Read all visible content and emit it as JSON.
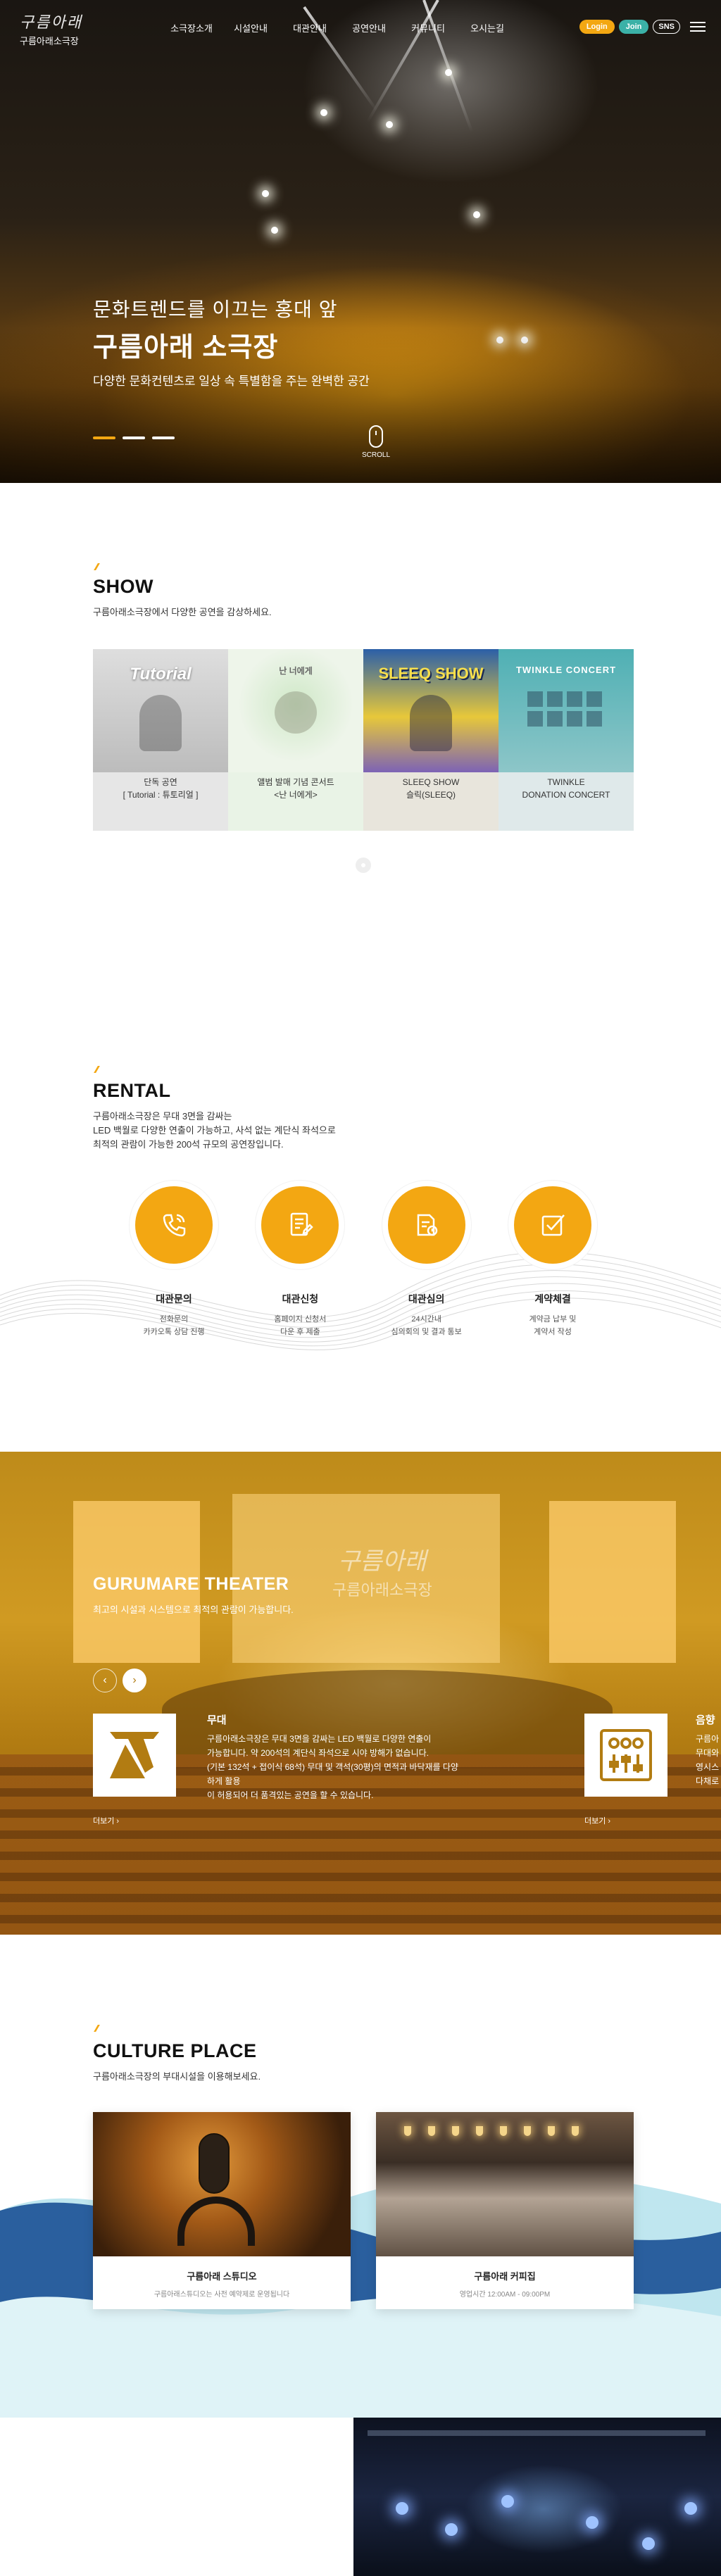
{
  "header": {
    "logo_art": "구름아래",
    "logo_text": "구름아래소극장",
    "nav": [
      "소극장소개",
      "시설안내",
      "대관안내",
      "공연안내",
      "커뮤니티",
      "오시는길"
    ],
    "login": "Login",
    "join": "Join",
    "sns": "SNS"
  },
  "hero": {
    "subtitle": "문화트렌드를 이끄는 홍대 앞",
    "title": "구름아래 소극장",
    "desc": "다양한 문화컨텐츠로 일상 속 특별함을 주는 완벽한 공간",
    "scroll": "SCROLL",
    "slides": 3,
    "active_slide": 1
  },
  "show": {
    "title": "SHOW",
    "desc": "구름아래소극장에서 다양한 공연을 감상하세요.",
    "cards": [
      {
        "poster_title": "Tutorial",
        "line1": "단독 공연",
        "line2": "[ Tutorial : 튜토리얼 ]"
      },
      {
        "poster_title": "난 너에게",
        "line1": "앨범 발매 기념 콘서트",
        "line2": "<난 너에게>"
      },
      {
        "poster_title": "SLEEQ SHOW",
        "line1": "SLEEQ SHOW",
        "line2": "슬릭(SLEEQ)"
      },
      {
        "poster_title": "TWINKLE CONCERT",
        "line1": "TWINKLE",
        "line2": "DONATION CONCERT"
      }
    ]
  },
  "rental": {
    "title": "RENTAL",
    "desc": "구름아래소극장은 무대 3면을 감싸는\nLED 백월로 다양한 연출이 가능하고, 사석 없는 계단식 좌석으로\n최적의 관람이 가능한 200석 규모의 공연장입니다.",
    "items": [
      {
        "title": "대관문의",
        "desc": "전화문의\n카카오톡 상담 진행",
        "icon": "phone-icon"
      },
      {
        "title": "대관신청",
        "desc": "홈페이지 신청서\n다운 후 제출",
        "icon": "document-icon"
      },
      {
        "title": "대관심의",
        "desc": "24시간내\n심의회의 및 결과 통보",
        "icon": "review-icon"
      },
      {
        "title": "계약체결",
        "desc": "계약금 납부 및\n계약서 작성",
        "icon": "contract-icon"
      }
    ]
  },
  "theater": {
    "title": "GURUMARE THEATER",
    "desc": "최고의 시설과 시스템으로 최적의 관람이 가능합니다.",
    "logo_art": "구름아래",
    "logo_text": "구름아래소극장",
    "prev": "‹",
    "next": "›",
    "items": [
      {
        "name": "무대",
        "text": "구름아래소극장은 무대 3면을 감싸는 LED 백월로 다양한 연출이\n가능합니다. 약 200석의 계단식 좌석으로 시야 방해가 없습니다.\n(기본 132석 + 접이식 68석) 무대 및 객석(30평)의 면적과 바닥재를 다양하게 활용\n이 허용되어 더 품격있는 공연을 할 수 있습니다.",
        "more": "더보기",
        "icon": "stage-light-icon"
      },
      {
        "name": "음향",
        "text": "구름아래\n무대와\n영시스\n다채로",
        "more": "더보기",
        "icon": "mixer-icon"
      }
    ]
  },
  "culture": {
    "title": "CULTURE PLACE",
    "desc": "구름아래소극장의 부대시설을 이용해보세요.",
    "cards": [
      {
        "name": "구름아래 스튜디오",
        "sub": "구름아래스튜디오는 사전 예약제로 운영됩니다"
      },
      {
        "name": "구름아래 커피집",
        "sub": "영업시간 12:00AM - 09:00PM"
      }
    ]
  },
  "colors": {
    "accent": "#f3a712",
    "join": "#3bb1a7",
    "wave_dark": "#2a5f9e",
    "wave_light": "#bfe6ef"
  }
}
